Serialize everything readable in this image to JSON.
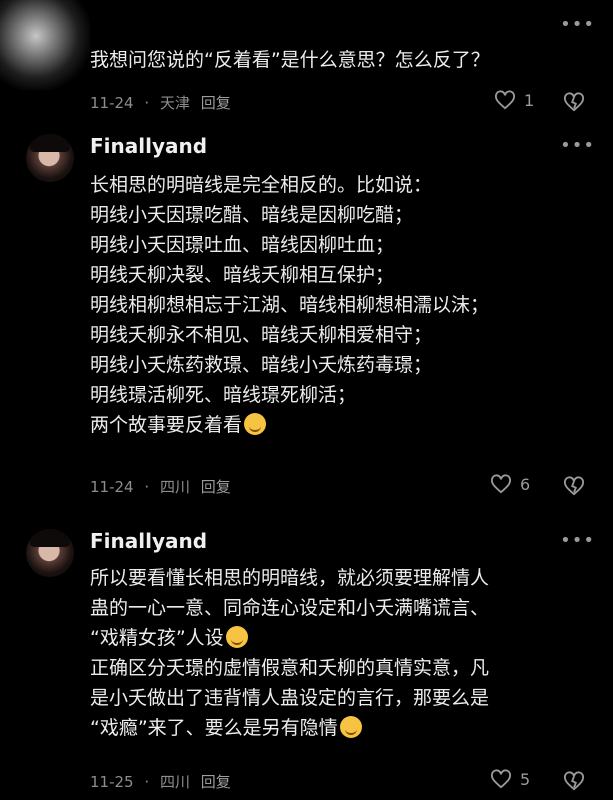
{
  "comments": [
    {
      "username": "",
      "text_lines": [
        "我想问您说的“反着看”是什么意思？怎么反了？"
      ],
      "date": "11-24",
      "location": "天津",
      "reply": "回复",
      "likes": "1"
    },
    {
      "username": "Finallyand",
      "text_lines": [
        "长相思的明暗线是完全相反的。比如说：",
        "明线小夭因璟吃醋、暗线是因柳吃醋；",
        "明线小夭因璟吐血、暗线因柳吐血；",
        "明线夭柳决裂、暗线夭柳相互保护；",
        "明线相柳想相忘于江湖、暗线相柳想相濡以沫；",
        "明线夭柳永不相见、暗线夭柳相爱相守；",
        "明线小夭炼药救璟、暗线小夭炼药毒璟；",
        "明线璟活柳死、暗线璟死柳活；",
        "两个故事要反着看"
      ],
      "date": "11-24",
      "location": "四川",
      "reply": "回复",
      "likes": "6"
    },
    {
      "username": "Finallyand",
      "text_lines": [
        "所以要看懂长相思的明暗线，就必须要理解情人",
        "蛊的一心一意、同命连心设定和小夭满嘴谎言、",
        "“戏精女孩”人设",
        "正确区分夭璟的虚情假意和夭柳的真情实意，凡",
        "是小夭做出了违背情人蛊设定的言行，那要么是",
        "“戏瘾”来了、要么是另有隐情"
      ],
      "date": "11-25",
      "location": "四川",
      "reply": "回复",
      "likes": "5"
    }
  ],
  "icons": {
    "more": "more-icon",
    "heart": "heart-icon",
    "heartbreak": "broken-heart-icon",
    "emoji_laugh": "rofl-emoji-icon",
    "emoji_sweat": "sweat-smile-emoji-icon",
    "emoji_hush": "hand-over-mouth-emoji-icon"
  },
  "separator": "·"
}
